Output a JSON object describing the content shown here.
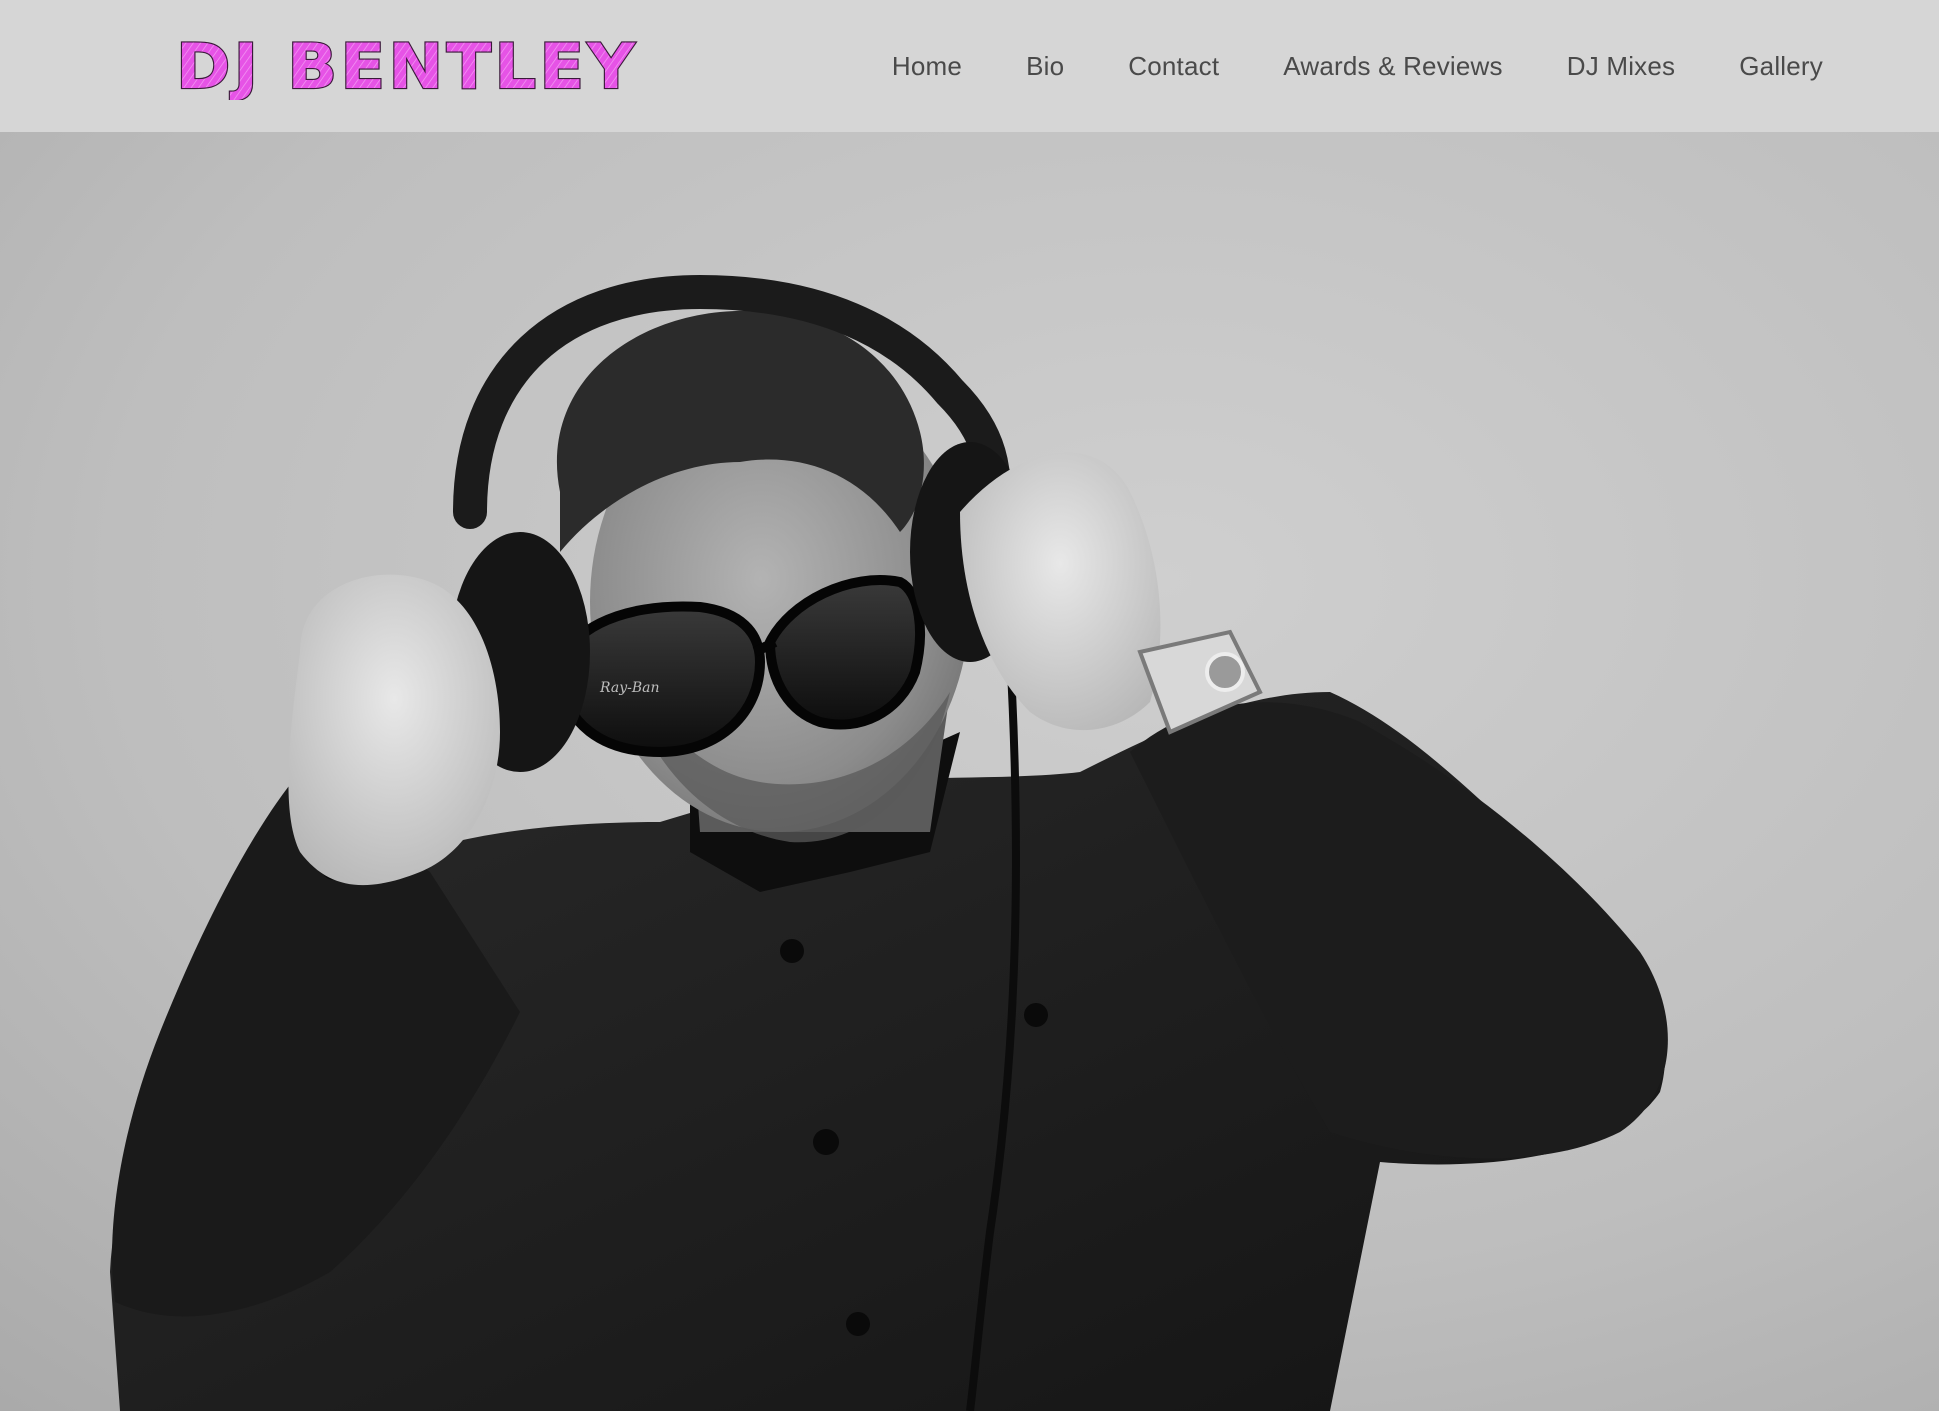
{
  "site": {
    "logo_text": "DJ BENTLEY",
    "logo_color": "#e653e6"
  },
  "nav": {
    "items": [
      {
        "label": "Home"
      },
      {
        "label": "Bio"
      },
      {
        "label": "Contact"
      },
      {
        "label": "Awards & Reviews"
      },
      {
        "label": "DJ Mixes"
      },
      {
        "label": "Gallery"
      }
    ]
  },
  "hero": {
    "photo_description_icon": "dj-portrait-photo",
    "glasses_brand": "Ray-Ban"
  },
  "colors": {
    "header_bg": "#d6d6d6",
    "nav_text": "#4a4a4a",
    "logo_fill": "#e653e6",
    "photo_bg": "#bdbdbd"
  }
}
